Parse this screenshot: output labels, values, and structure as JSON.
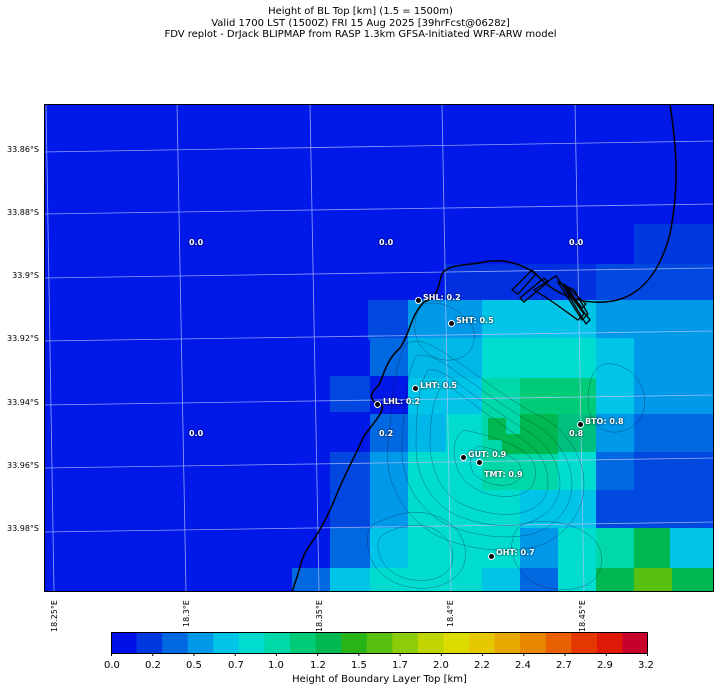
{
  "title": {
    "line1": "Height of BL Top [km] (1.5 = 1500m)",
    "line2": "Valid 1700 LST (1500Z) FRI 15 Aug 2025 [39hrFcst@0628z]",
    "line3": "FDV replot - DrJack BLIPMAP from RASP 1.3km GFSA-Initiated WRF-ARW model"
  },
  "lat_labels": [
    "33.86°S",
    "33.88°S",
    "33.9°S",
    "33.92°S",
    "33.94°S",
    "33.96°S",
    "33.98°S"
  ],
  "lon_labels": [
    "18.25°E",
    "18.3°E",
    "18.35°E",
    "18.4°E",
    "18.45°E"
  ],
  "grid_values": [
    "0.0",
    "0.0",
    "0.0",
    "0.0",
    "0.2",
    "0.8"
  ],
  "sites": [
    {
      "label": "SHL: 0.2"
    },
    {
      "label": "SHT: 0.5"
    },
    {
      "label": "LHT: 0.5"
    },
    {
      "label": "LHL: 0.2"
    },
    {
      "label": "BTO: 0.8"
    },
    {
      "label": "GUT: 0.9"
    },
    {
      "label": "TMT: 0.9"
    },
    {
      "label": "OHT: 0.7"
    }
  ],
  "colorbar": {
    "title": "Height of Boundary Layer Top [km]",
    "tick_labels": [
      "0.0",
      "0.2",
      "0.5",
      "0.7",
      "1.0",
      "1.2",
      "1.5",
      "1.7",
      "2.0",
      "2.2",
      "2.4",
      "2.7",
      "2.9",
      "3.2"
    ],
    "colors": [
      "#0010e8",
      "#0038e0",
      "#0068e0",
      "#0098e8",
      "#00c4e8",
      "#00dcd0",
      "#00d8a8",
      "#00cc78",
      "#00b850",
      "#28b418",
      "#58c010",
      "#8ccc08",
      "#c0d400",
      "#dcdc00",
      "#e6c800",
      "#e8a800",
      "#e88800",
      "#e86000",
      "#e43800",
      "#e01808",
      "#c8002c"
    ]
  },
  "map_colors": {
    "sea": "#0018e8",
    "land_outline": "#000000"
  }
}
